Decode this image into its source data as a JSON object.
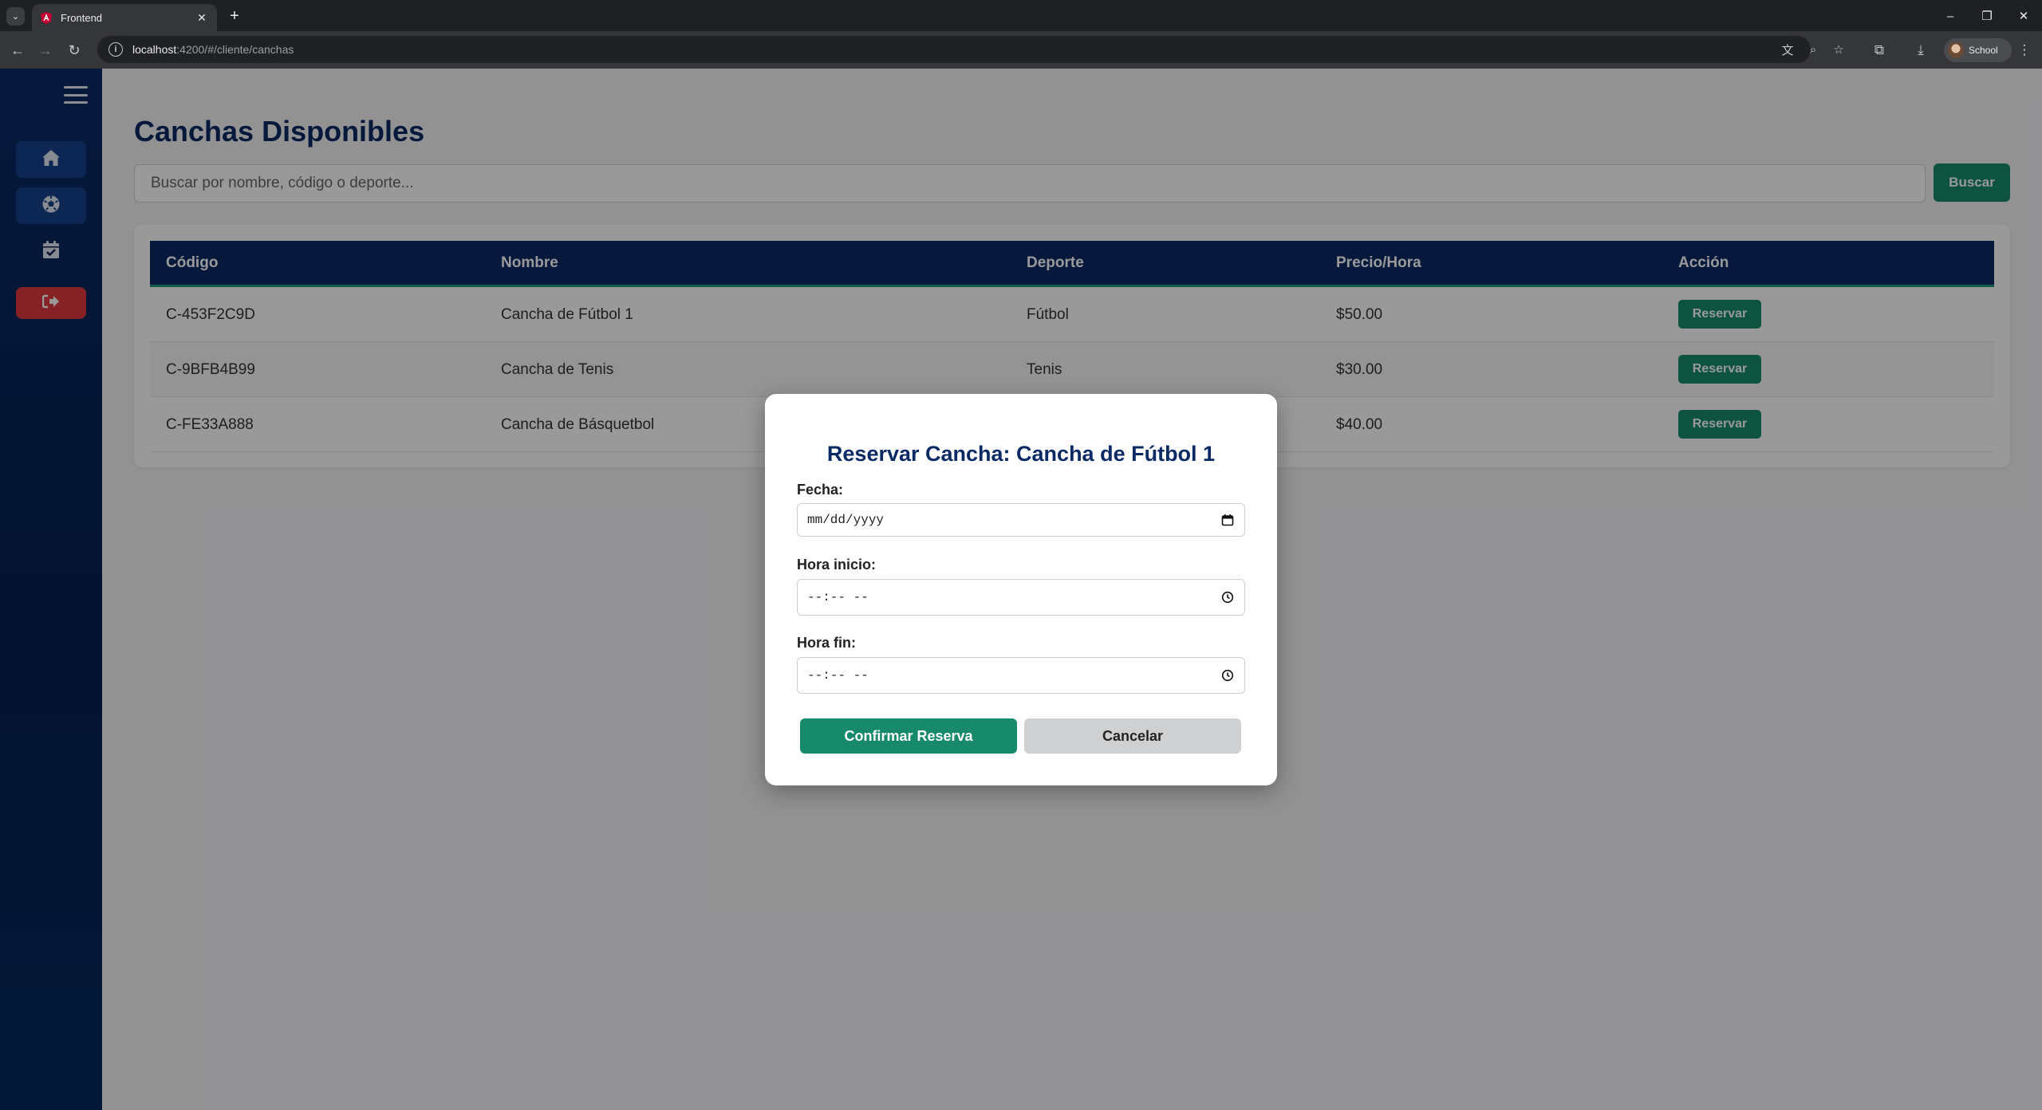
{
  "browser": {
    "tab_title": "Frontend",
    "tab_close": "✕",
    "new_tab": "+",
    "url_host": "localhost",
    "url_path": ":4200/#/cliente/canchas",
    "profile_name": "School",
    "window_controls": {
      "minimize": "–",
      "restore": "❐",
      "close": "✕"
    }
  },
  "sidebar": {
    "items": [
      {
        "name": "home",
        "icon": "home-icon"
      },
      {
        "name": "canchas",
        "icon": "soccer-ball-icon"
      },
      {
        "name": "reservas",
        "icon": "calendar-check-icon"
      },
      {
        "name": "logout",
        "icon": "sign-out-icon"
      }
    ]
  },
  "page": {
    "title": "Canchas Disponibles",
    "search_placeholder": "Buscar por nombre, código o deporte...",
    "search_button": "Buscar"
  },
  "table": {
    "headers": [
      "Código",
      "Nombre",
      "Deporte",
      "Precio/Hora",
      "Acción"
    ],
    "rows": [
      {
        "codigo": "C-453F2C9D",
        "nombre": "Cancha de Fútbol 1",
        "deporte": "Fútbol",
        "precio": "$50.00",
        "accion": "Reservar"
      },
      {
        "codigo": "C-9BFB4B99",
        "nombre": "Cancha de Tenis",
        "deporte": "Tenis",
        "precio": "$30.00",
        "accion": "Reservar"
      },
      {
        "codigo": "C-FE33A888",
        "nombre": "Cancha de Básquetbol",
        "deporte": "",
        "precio": "$40.00",
        "accion": "Reservar"
      }
    ]
  },
  "modal": {
    "title": "Reservar Cancha: Cancha de Fútbol 1",
    "fecha_label": "Fecha:",
    "fecha_value": "mm/dd/yyyy",
    "hora_inicio_label": "Hora inicio:",
    "hora_inicio_value": "--:-- --",
    "hora_fin_label": "Hora fin:",
    "hora_fin_value": "--:-- --",
    "confirm_button": "Confirmar Reserva",
    "cancel_button": "Cancelar"
  },
  "colors": {
    "navy": "#0a2a66",
    "accent_green": "#178a6c",
    "logout_red": "#e0383e"
  }
}
